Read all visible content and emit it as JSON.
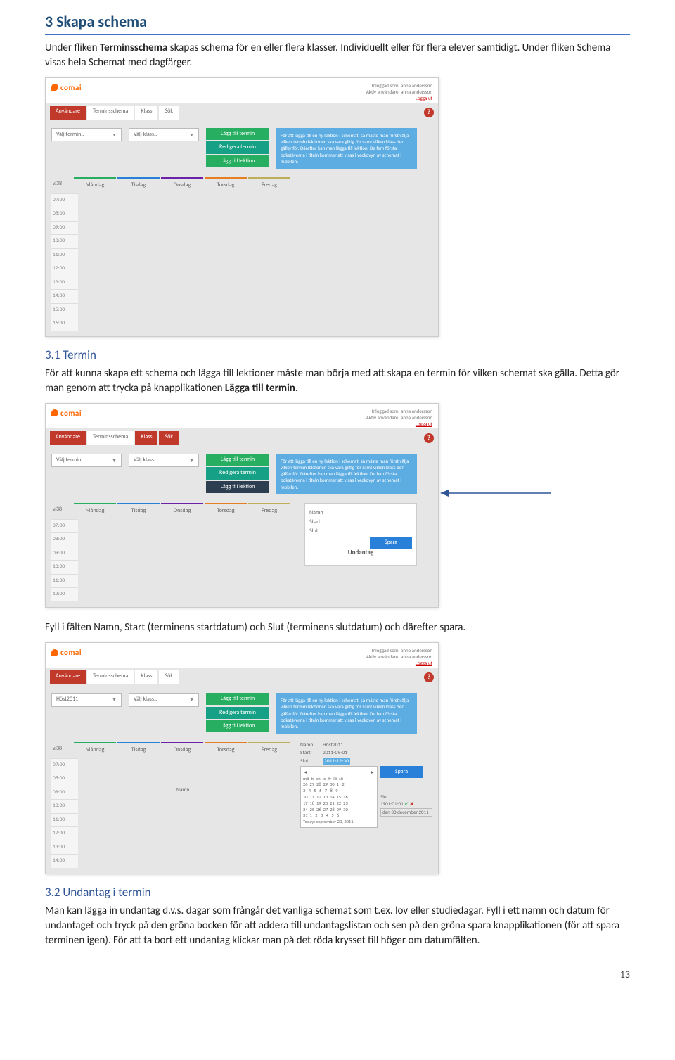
{
  "section3": {
    "title": "3 Skapa schema",
    "p1_a": "Under fliken ",
    "p1_b": "Terminsschema",
    "p1_c": " skapas schema för en eller flera klasser. Individuellt eller för flera elever samtidigt. Under fliken Schema visas hela Schemat med dagfärger."
  },
  "section31": {
    "title": "3.1 Termin",
    "p1_a": "För att kunna skapa ett schema och lägga till lektioner måste man börja med att skapa en termin för vilken schemat ska gälla. Detta gör man genom att trycka på knapplikationen ",
    "p1_b": "Lägga till termin",
    "p1_c": ".",
    "p2": "Fyll i fälten Namn, Start (terminens startdatum) och Slut (terminens slutdatum)  och därefter spara."
  },
  "section32": {
    "title": "3.2 Undantag i termin",
    "p1": "Man kan lägga in undantag d.v.s. dagar som frångår det vanliga schemat som t.ex. lov eller studiedagar. Fyll i ett namn och datum för undantaget och tryck på den gröna bocken för att addera till undantagslistan och sen på den gröna spara knapplikationen (för att spara terminen igen). För att ta bort ett undantag klickar man på det röda krysset till höger om datumfälten."
  },
  "page": "13",
  "app": {
    "logo": "comai",
    "login_a": "Inloggad som: anna andersson",
    "login_b": "Aktiv användare: anna andersson",
    "logout": "Logga ut",
    "help": "?",
    "tabs": {
      "a": "Användare",
      "b": "Terminsschema",
      "c": "Klass",
      "d": "Sök"
    },
    "select_termin": "Välj termin..",
    "select_termin2": "Höst2011",
    "select_klass": "Välj klass..",
    "btn_add_termin": "Lägg till termin",
    "btn_edit_termin": "Redigera termin",
    "btn_add_lesson": "Lägg till lektion",
    "info": "För att lägga till en ny lektion i schemat, så måste man först välja vilken termin lektionen ska vara giltig för samt vilken klass den gäller för. Därefter kan man lägga till lektion. De fem första bokstäverna i titeln kommer att visas i veckovyn av schemat i mobilen.",
    "weeklabel": "v.38",
    "days": {
      "mon": "Måndag",
      "tue": "Tisdag",
      "wed": "Onsdag",
      "thu": "Torsdag",
      "fri": "Fredag"
    },
    "times1": [
      "07:00",
      "08:00",
      "09:00",
      "10:00",
      "11:00",
      "12:00",
      "13:00",
      "14:00",
      "15:00",
      "16:00"
    ],
    "times2": [
      "07:00",
      "08:00",
      "09:00",
      "10:00",
      "11:00",
      "12:00"
    ],
    "times3": [
      "07:00",
      "08:00",
      "09:00",
      "10:00",
      "11:00",
      "12:00",
      "13:00",
      "14:00"
    ],
    "panel2": {
      "namn": "Namn",
      "start": "Start",
      "slut": "Slut",
      "undantag": "Undantag",
      "spara": "Spara"
    },
    "panel3": {
      "namn_l": "Namn",
      "namn_v": "Höst2011",
      "start_l": "Start",
      "start_v": "2011-09-01",
      "slut_l": "Slut",
      "slut_v": "2011-12-30",
      "cal_days": "må  ti  on  to  fr  lö  sö",
      "cal_r1": "26  27  28  29  30  1   2",
      "cal_r2": "3   4   5   6   7   8   9",
      "cal_r3": "10  11  12  13  14  15  16",
      "cal_r4": "17  18  19  20  21  22  23",
      "cal_r5": "24  25  26  27  28  29  30",
      "cal_r6": "31  1   2   3   4   5   6",
      "cal_today": "Today: september 20, 2011",
      "cal_sel": "den 30 december 2011",
      "und_start": "1901-01-01",
      "namn2": "Namn",
      "slut2": "Slut"
    }
  }
}
